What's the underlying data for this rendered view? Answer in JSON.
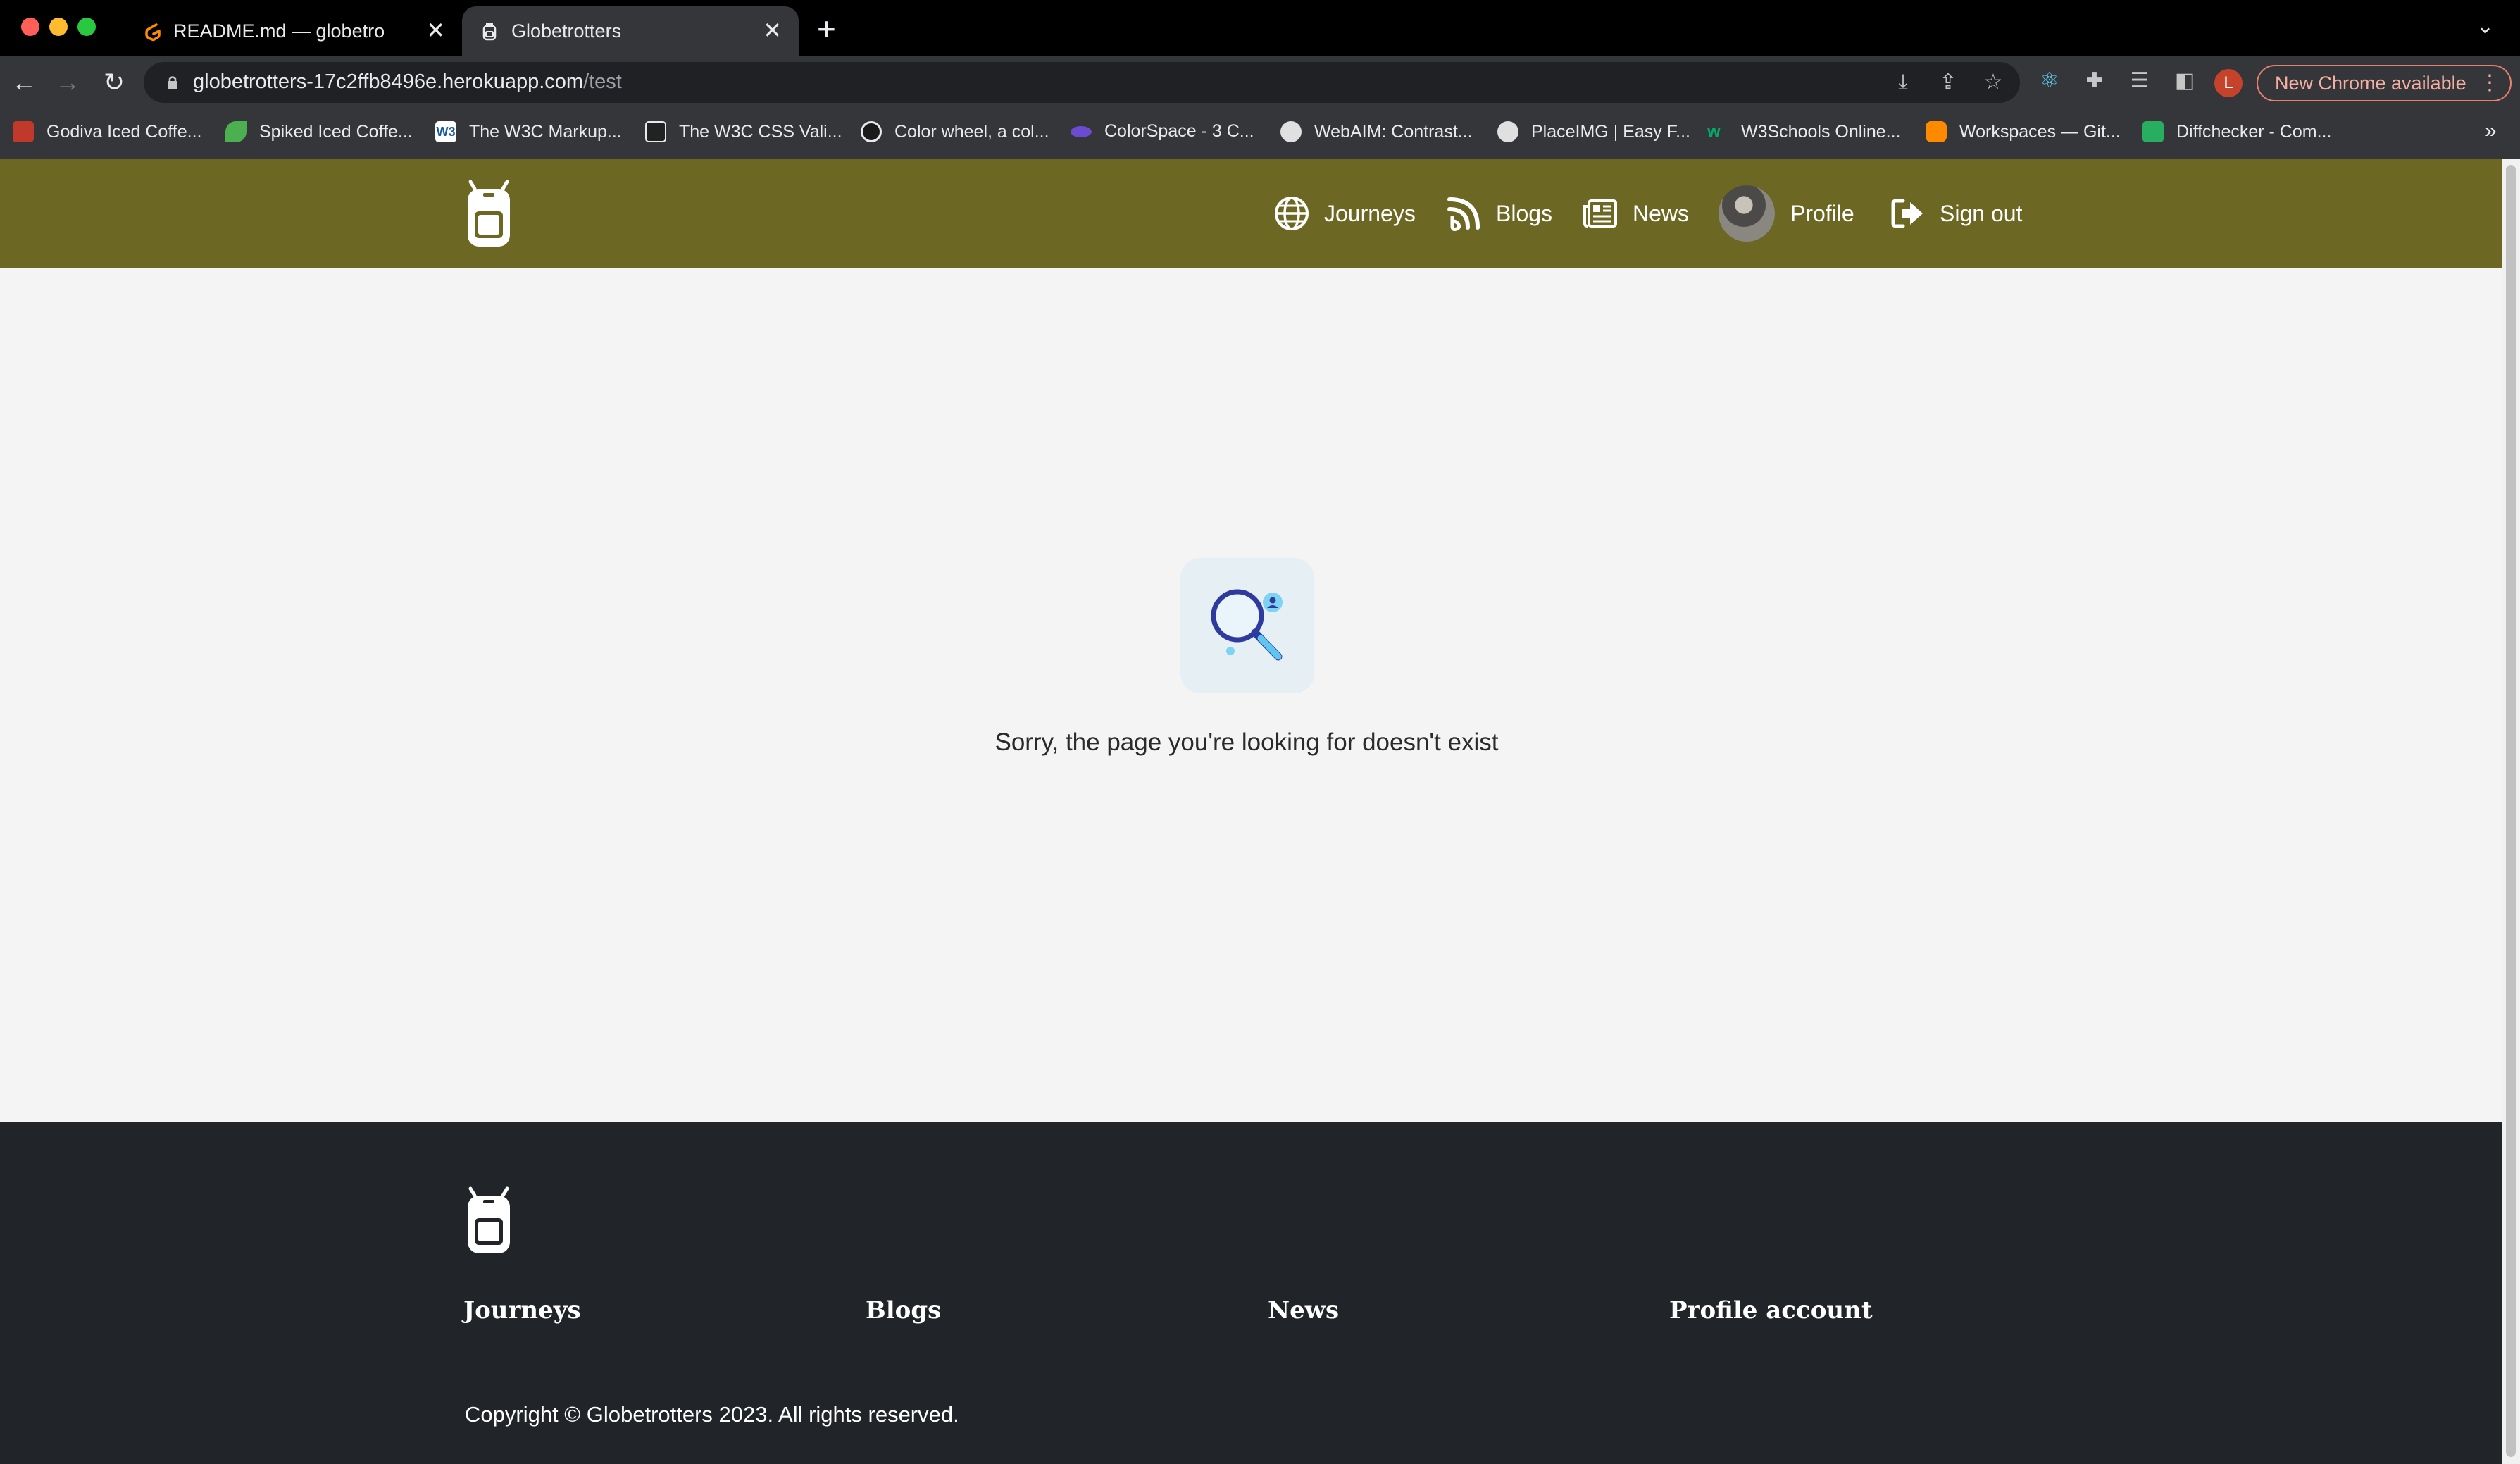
{
  "browser": {
    "tabs": [
      {
        "title": "README.md — globetrotter — ",
        "icon": "gitpod-icon",
        "active": false
      },
      {
        "title": "Globetrotters",
        "icon": "backpack-icon",
        "active": true
      }
    ],
    "url_host": "globetrotters-17c2ffb8496e.herokuapp.com",
    "url_path": "/test",
    "profile_initial": "L",
    "update_label": "New Chrome available",
    "bookmarks": [
      {
        "label": "Godiva Iced Coffe...",
        "icon": "godiva-icon",
        "color": "#c0392b"
      },
      {
        "label": "Spiked Iced Coffe...",
        "icon": "leaf-icon",
        "color": "#4caf50"
      },
      {
        "label": "The W3C Markup...",
        "icon": "w3c-icon",
        "color": "#ffffff"
      },
      {
        "label": "The W3C CSS Vali...",
        "icon": "w3c-css-icon",
        "color": "#222222"
      },
      {
        "label": "Color wheel, a col...",
        "icon": "color-wheel-icon",
        "color": "#1a1a1a"
      },
      {
        "label": "ColorSpace - 3 C...",
        "icon": "colorspace-icon",
        "color": "#6c4bd1"
      },
      {
        "label": "WebAIM: Contrast...",
        "icon": "webaim-icon",
        "color": "#e0e0e0"
      },
      {
        "label": "PlaceIMG | Easy F...",
        "icon": "globe-icon",
        "color": "#e0e0e0"
      },
      {
        "label": "W3Schools Online...",
        "icon": "w3schools-icon",
        "color": "#04aa6d"
      },
      {
        "label": "Workspaces — Git...",
        "icon": "gitpod-icon",
        "color": "#ff8a00"
      },
      {
        "label": "Diffchecker - Com...",
        "icon": "diffchecker-icon",
        "color": "#27ae60"
      }
    ]
  },
  "header": {
    "logo": "backpack-logo-icon",
    "nav": [
      {
        "label": "Journeys",
        "icon": "globe-icon"
      },
      {
        "label": "Blogs",
        "icon": "blog-feed-icon"
      },
      {
        "label": "News",
        "icon": "newspaper-icon"
      },
      {
        "label": "Profile",
        "icon": "avatar"
      },
      {
        "label": "Sign out",
        "icon": "sign-out-icon"
      }
    ],
    "bg_color": "#6c6823"
  },
  "main": {
    "illustration": "no-results-search-icon",
    "message": "Sorry, the page you're looking for doesn't exist"
  },
  "footer": {
    "logo": "backpack-logo-icon",
    "links": [
      "Journeys",
      "Blogs",
      "News",
      "Profile account"
    ],
    "copyright": "Copyright © Globetrotters 2023. All rights reserved.",
    "bg_color": "#212429"
  }
}
